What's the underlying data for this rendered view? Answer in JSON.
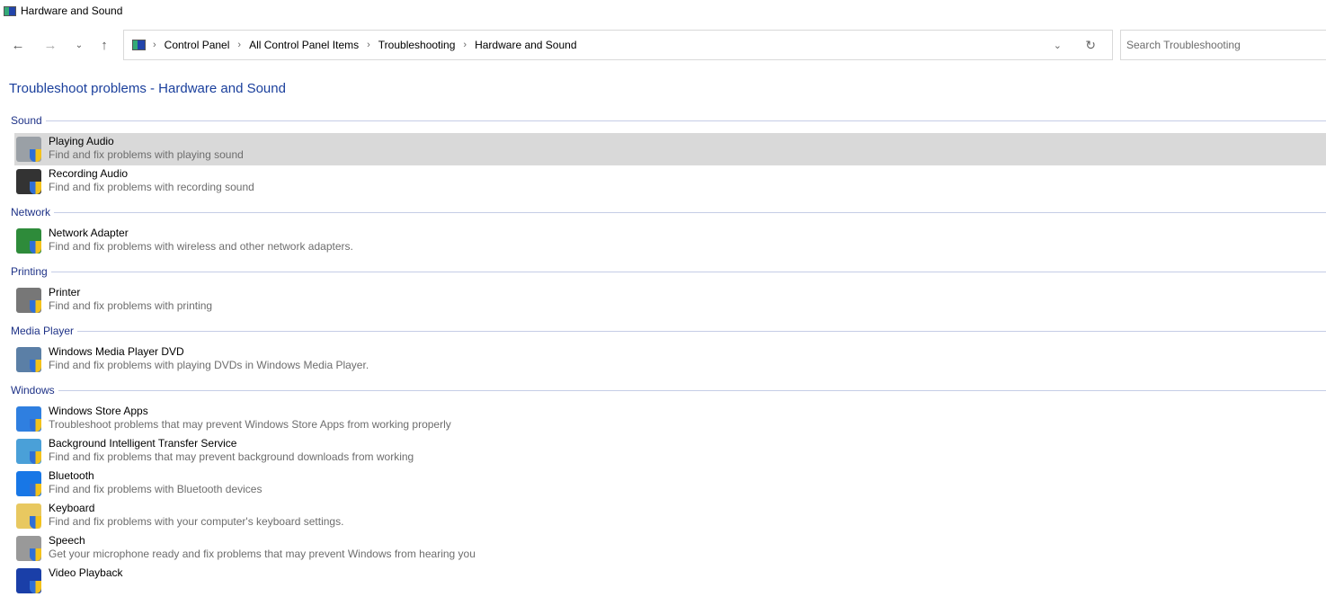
{
  "window": {
    "title": "Hardware and Sound"
  },
  "breadcrumb": [
    "Control Panel",
    "All Control Panel Items",
    "Troubleshooting",
    "Hardware and Sound"
  ],
  "search": {
    "placeholder": "Search Troubleshooting"
  },
  "heading": "Troubleshoot problems - Hardware and Sound",
  "groups": [
    {
      "name": "Sound",
      "items": [
        {
          "title": "Playing Audio",
          "desc": "Find and fix problems with playing sound",
          "icon": "speaker-icon",
          "color": "#9aa0a6"
        },
        {
          "title": "Recording Audio",
          "desc": "Find and fix problems with recording sound",
          "icon": "microphone-icon",
          "color": "#333333"
        }
      ]
    },
    {
      "name": "Network",
      "items": [
        {
          "title": "Network Adapter",
          "desc": "Find and fix problems with wireless and other network adapters.",
          "icon": "network-adapter-icon",
          "color": "#2e8b3a"
        }
      ]
    },
    {
      "name": "Printing",
      "items": [
        {
          "title": "Printer",
          "desc": "Find and fix problems with printing",
          "icon": "printer-icon",
          "color": "#777777"
        }
      ]
    },
    {
      "name": "Media Player",
      "items": [
        {
          "title": "Windows Media Player DVD",
          "desc": "Find and fix problems with playing DVDs in Windows Media Player.",
          "icon": "dvd-icon",
          "color": "#5b7fa6"
        }
      ]
    },
    {
      "name": "Windows",
      "items": [
        {
          "title": "Windows Store Apps",
          "desc": "Troubleshoot problems that may prevent Windows Store Apps from working properly",
          "icon": "store-icon",
          "color": "#2f7fe0"
        },
        {
          "title": "Background Intelligent Transfer Service",
          "desc": "Find and fix problems that may prevent background downloads from working",
          "icon": "transfer-icon",
          "color": "#4aa0d8"
        },
        {
          "title": "Bluetooth",
          "desc": "Find and fix problems with Bluetooth devices",
          "icon": "bluetooth-icon",
          "color": "#1877e6"
        },
        {
          "title": "Keyboard",
          "desc": "Find and fix problems with your computer's keyboard settings.",
          "icon": "keyboard-icon",
          "color": "#e8c860"
        },
        {
          "title": "Speech",
          "desc": "Get your microphone ready and fix problems that may prevent Windows from hearing you",
          "icon": "speech-icon",
          "color": "#999999"
        },
        {
          "title": "Video Playback",
          "desc": "",
          "icon": "video-playback-icon",
          "color": "#1a3fa8"
        }
      ]
    }
  ]
}
